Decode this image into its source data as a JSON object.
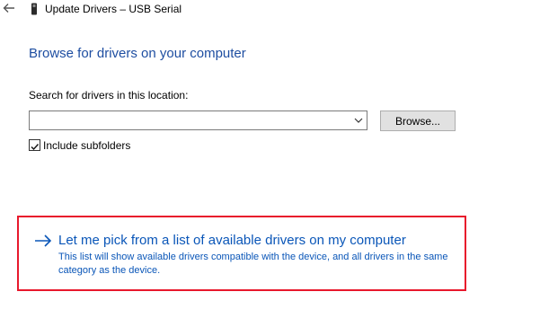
{
  "window": {
    "title": "Update Drivers – USB Serial"
  },
  "icons": {
    "back": "back-arrow-icon",
    "device": "usb-device-icon",
    "chevron": "chevron-down-icon",
    "checkmark": "checkmark-icon",
    "link_arrow": "arrow-right-icon"
  },
  "colors": {
    "heading": "#1e4ea1",
    "link": "#0a56b8",
    "highlight": "#e8182c"
  },
  "main": {
    "heading": "Browse for drivers on your computer",
    "search_label": "Search for drivers in this location:",
    "search_value": "",
    "browse_label": "Browse...",
    "include_subfolders_label": "Include subfolders",
    "include_subfolders_checked": true,
    "pick_title": "Let me pick from a list of available drivers on my computer",
    "pick_description": "This list will show available drivers compatible with the device, and all drivers in the same category as the device."
  }
}
